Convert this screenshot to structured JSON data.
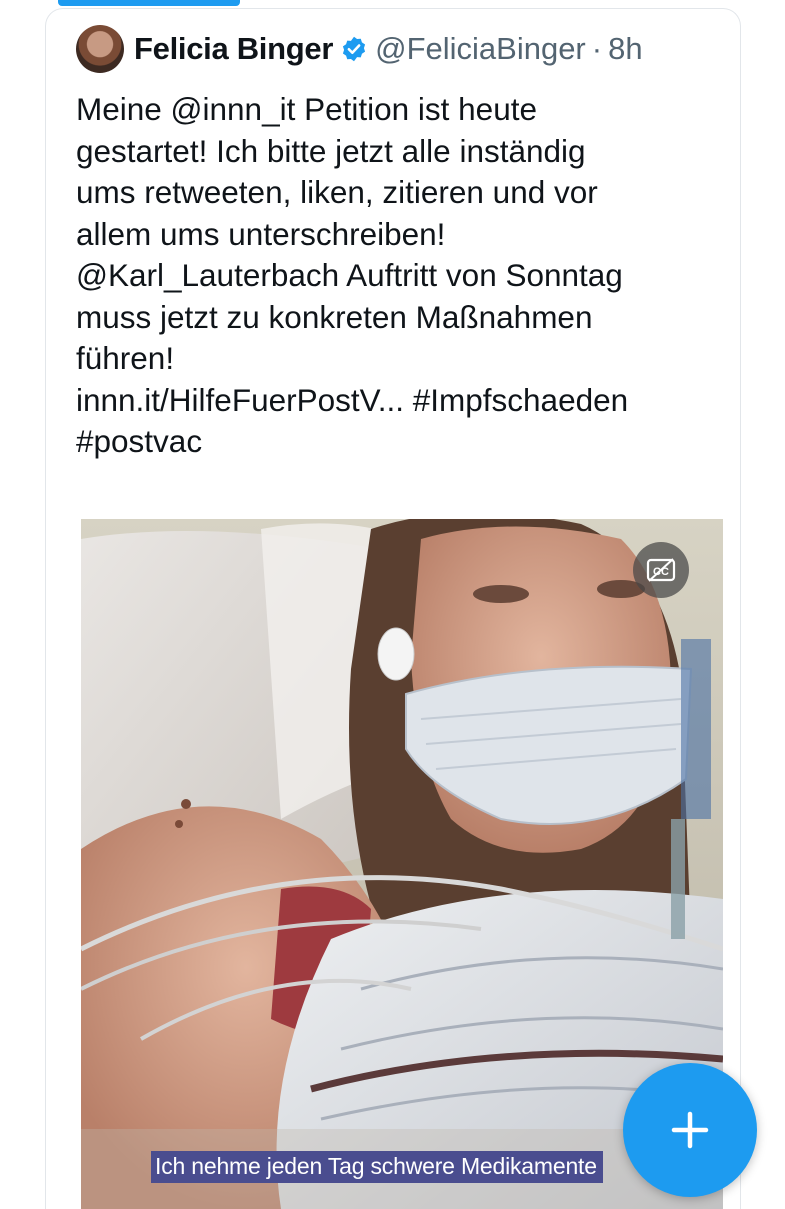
{
  "tweet": {
    "author_name": "Felicia Binger",
    "handle": "@FeliciaBinger",
    "separator": "·",
    "time": "8h",
    "verified": true,
    "text_lines": [
      "Meine @innn_it Petition ist heute",
      "gestartet! Ich bitte jetzt alle inständig",
      "ums retweeten, liken, zitieren und vor",
      "allem ums unterschreiben!",
      "@Karl_Lauterbach Auftritt von Sonntag",
      "muss jetzt zu konkreten Maßnahmen",
      "führen!",
      "innn.it/HilfeFuerPostV... #Impfschaeden",
      "#postvac"
    ]
  },
  "media": {
    "subtitle": "Ich nehme jeden Tag schwere Medikamente"
  },
  "icons": {
    "verified": "verified-badge-icon",
    "captions": "closed-captions-icon",
    "compose": "plus-icon"
  },
  "colors": {
    "accent": "#1d9bf0",
    "secondary_text": "#536471",
    "subtitle_bg": "#4a4d8f"
  }
}
